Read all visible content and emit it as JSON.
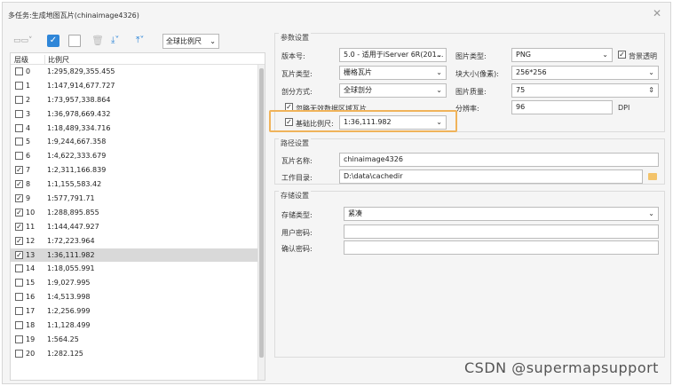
{
  "window": {
    "title": "多任务:生成地图瓦片(chinaimage4326)"
  },
  "toolbar": {
    "scale_select": "全球比例尺"
  },
  "table": {
    "header_level": "层级",
    "header_scale": "比例尺",
    "rows": [
      {
        "level": "0",
        "scale": "1:295,829,355.455",
        "checked": false
      },
      {
        "level": "1",
        "scale": "1:147,914,677.727",
        "checked": false
      },
      {
        "level": "2",
        "scale": "1:73,957,338.864",
        "checked": false
      },
      {
        "level": "3",
        "scale": "1:36,978,669.432",
        "checked": false
      },
      {
        "level": "4",
        "scale": "1:18,489,334.716",
        "checked": false
      },
      {
        "level": "5",
        "scale": "1:9,244,667.358",
        "checked": false
      },
      {
        "level": "6",
        "scale": "1:4,622,333.679",
        "checked": false
      },
      {
        "level": "7",
        "scale": "1:2,311,166.839",
        "checked": true
      },
      {
        "level": "8",
        "scale": "1:1,155,583.42",
        "checked": true
      },
      {
        "level": "9",
        "scale": "1:577,791.71",
        "checked": true
      },
      {
        "level": "10",
        "scale": "1:288,895.855",
        "checked": true
      },
      {
        "level": "11",
        "scale": "1:144,447.927",
        "checked": true
      },
      {
        "level": "12",
        "scale": "1:72,223.964",
        "checked": true
      },
      {
        "level": "13",
        "scale": "1:36,111.982",
        "checked": true,
        "selected": true
      },
      {
        "level": "14",
        "scale": "1:18,055.991",
        "checked": false
      },
      {
        "level": "15",
        "scale": "1:9,027.995",
        "checked": false
      },
      {
        "level": "16",
        "scale": "1:4,513.998",
        "checked": false
      },
      {
        "level": "17",
        "scale": "1:2,256.999",
        "checked": false
      },
      {
        "level": "18",
        "scale": "1:1,128.499",
        "checked": false
      },
      {
        "level": "19",
        "scale": "1:564.25",
        "checked": false
      },
      {
        "level": "20",
        "scale": "1:282.125",
        "checked": false
      }
    ]
  },
  "params": {
    "group_title": "参数设置",
    "version_label": "版本号:",
    "version_value": "5.0 - 适用于iServer 6R(201...",
    "image_type_label": "图片类型:",
    "image_type_value": "PNG",
    "transparent_label": "背景透明",
    "tile_type_label": "瓦片类型:",
    "tile_type_value": "栅格瓦片",
    "tile_size_label": "块大小(像素):",
    "tile_size_value": "256*256",
    "split_label": "剖分方式:",
    "split_value": "全球剖分",
    "quality_label": "图片质量:",
    "quality_value": "75",
    "ignore_empty_label": "忽略无效数据区域瓦片",
    "resolution_label": "分辨率:",
    "resolution_value": "96",
    "dpi_label": "DPI",
    "base_scale_label": "基础比例尺:",
    "base_scale_value": "1:36,111.982"
  },
  "path": {
    "group_title": "路径设置",
    "name_label": "瓦片名称:",
    "name_value": "chinaimage4326",
    "dir_label": "工作目录:",
    "dir_value": "D:\\data\\cachedir"
  },
  "storage": {
    "group_title": "存储设置",
    "type_label": "存储类型:",
    "type_value": "紧凑",
    "user_pw_label": "用户密码:",
    "confirm_pw_label": "确认密码:"
  },
  "watermark": "CSDN @supermapsupport",
  "colors": {
    "accent": "#2f86d8",
    "highlight": "#f0b35a",
    "selected_row": "#d9d9d9"
  }
}
